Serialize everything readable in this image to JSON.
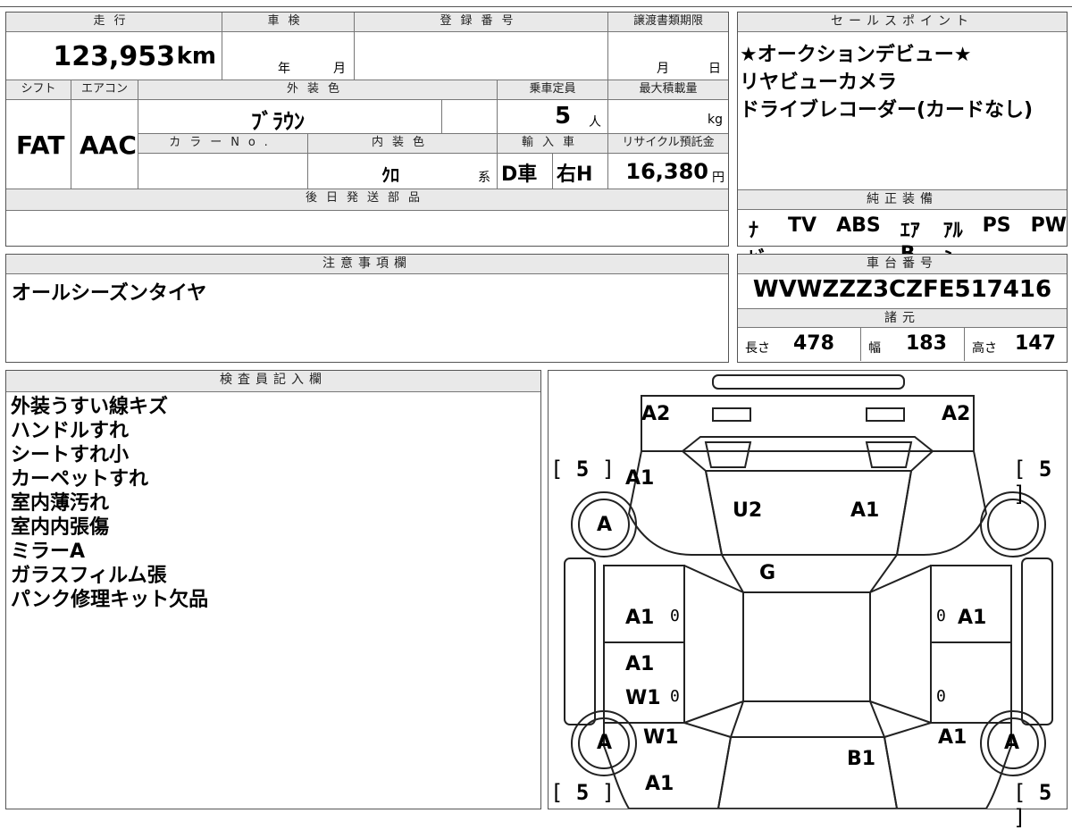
{
  "main": {
    "mileage": {
      "label": "走行",
      "value": "123,953",
      "unit": "km"
    },
    "inspection": {
      "label": "車検",
      "year": "年",
      "month": "月"
    },
    "registration": {
      "label": "登録番号"
    },
    "transfer_docs": {
      "label": "譲渡書類期限",
      "month": "月",
      "day": "日"
    },
    "shift": {
      "label": "シフト",
      "value": "FAT"
    },
    "aircon": {
      "label": "エアコン",
      "value": "AAC"
    },
    "exterior_color": {
      "label": "外装色",
      "value": "ﾌﾞﾗｳﾝ"
    },
    "capacity": {
      "label": "乗車定員",
      "value": "5",
      "unit": "人"
    },
    "max_load": {
      "label": "最大積載量",
      "unit": "kg"
    },
    "color_no": {
      "label": "カラーNo."
    },
    "interior_color": {
      "label": "内装色",
      "value": "ｸﾛ",
      "suffix": "系"
    },
    "import": {
      "label": "輸入車",
      "dealer": "D車",
      "handle": "右H"
    },
    "recycle": {
      "label": "リサイクル預託金",
      "value": "16,380",
      "unit": "円"
    },
    "later_parts": {
      "label": "後日発送部品"
    }
  },
  "sales_points": {
    "label": "セールスポイント",
    "lines": [
      "★オークションデビュー★",
      "リヤビューカメラ",
      "ドライブレコーダー(カードなし)"
    ]
  },
  "equipment": {
    "label": "純正装備",
    "items": [
      "ﾅﾋﾞ",
      "TV",
      "ABS",
      "ｴｱB",
      "ｱﾙﾐ",
      "PS",
      "PW"
    ]
  },
  "notes": {
    "label": "注意事項欄",
    "text": "オールシーズンタイヤ"
  },
  "chassis": {
    "label": "車台番号",
    "value": "WVWZZZ3CZFE517416"
  },
  "specs": {
    "label": "諸元",
    "length_label": "長さ",
    "length": "478",
    "width_label": "幅",
    "width": "183",
    "height_label": "高さ",
    "height": "147"
  },
  "inspector": {
    "label": "検査員記入欄",
    "lines": [
      "外装うすい線キズ",
      "ハンドルすれ",
      "シートすれ小",
      "カーペットすれ",
      "室内薄汚れ",
      "室内内張傷",
      "ミラーA",
      "ガラスフィルム張",
      "パンク修理キット欠品"
    ]
  },
  "diagram": {
    "tire_left_front": "5",
    "tire_right_front": "5",
    "tire_left_rear": "5",
    "tire_right_rear": "5",
    "marks": {
      "front_left": "A2",
      "front_right": "A2",
      "fender_left": "A1",
      "hood_left": "U2",
      "hood_right": "A1",
      "wheel_fl": "A",
      "wheel_rl": "A",
      "wheel_rr": "A",
      "glass": "G",
      "door_fl": "A1",
      "door_fr": "A1",
      "door_rl_1": "A1",
      "door_rl_2": "W1",
      "rear_fender_l": "W1",
      "rear_fender_r": "A1",
      "rear_l": "A1",
      "trunk": "B1",
      "zero": "0"
    }
  }
}
